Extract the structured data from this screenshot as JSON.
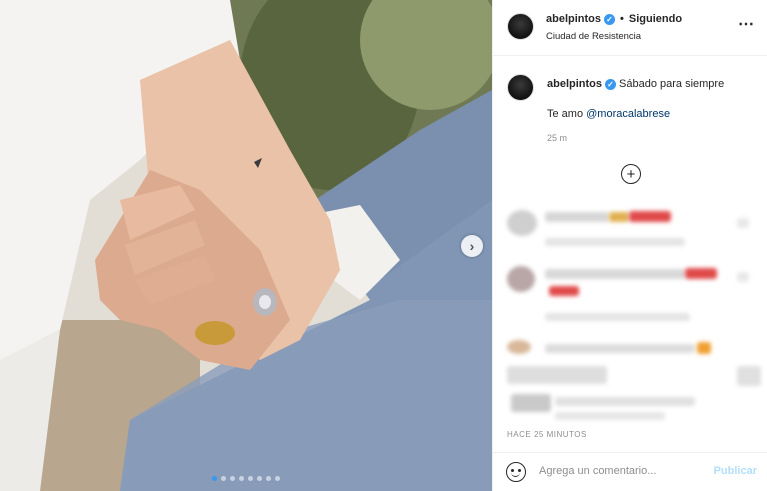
{
  "header": {
    "username": "abelpintos",
    "follow_status": "Siguiendo",
    "separator": "•",
    "location": "Ciudad de Resistencia",
    "more_icon": "⋯"
  },
  "caption": {
    "username": "abelpintos",
    "text": "Sábado para siempre",
    "line2_prefix": "Te amo ",
    "mention": "@moracalabrese",
    "time": "25 m"
  },
  "load_more_icon": "+",
  "next_icon": "›",
  "carousel": {
    "count": 8,
    "active": 0
  },
  "posted_ago": "HACE 25 MINUTOS",
  "comment_box": {
    "placeholder": "Agrega un comentario...",
    "publish_label": "Publicar"
  },
  "colors": {
    "accent": "#3897f0",
    "publish_disabled": "#b2dffc"
  }
}
